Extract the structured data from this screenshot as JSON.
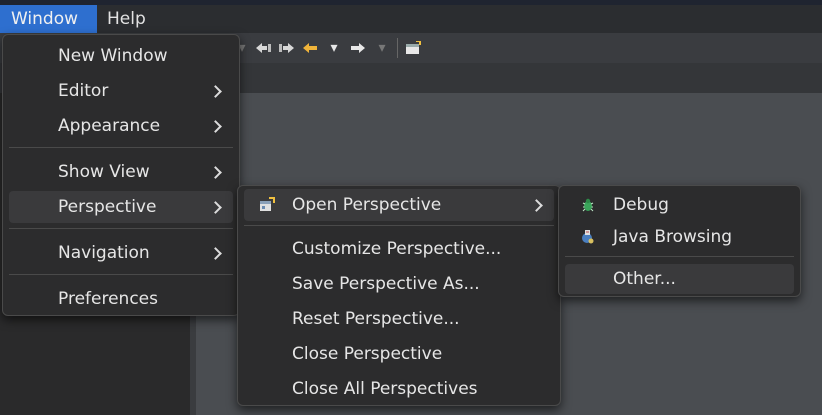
{
  "menubar": {
    "window_label": "Window",
    "help_label": "Help"
  },
  "window_menu": {
    "new_window": "New Window",
    "editor": "Editor",
    "appearance": "Appearance",
    "show_view": "Show View",
    "perspective": "Perspective",
    "navigation": "Navigation",
    "preferences": "Preferences"
  },
  "perspective_menu": {
    "open_perspective": "Open Perspective",
    "customize": "Customize Perspective...",
    "save_as": "Save Perspective As...",
    "reset": "Reset Perspective...",
    "close": "Close Perspective",
    "close_all": "Close All Perspectives"
  },
  "open_perspective_menu": {
    "debug": "Debug",
    "java_browsing": "Java Browsing",
    "other": "Other..."
  },
  "colors": {
    "menubar_active": "#2e6fcf",
    "menu_bg": "#2c2c2d",
    "editor_bg": "#4a4d51"
  }
}
